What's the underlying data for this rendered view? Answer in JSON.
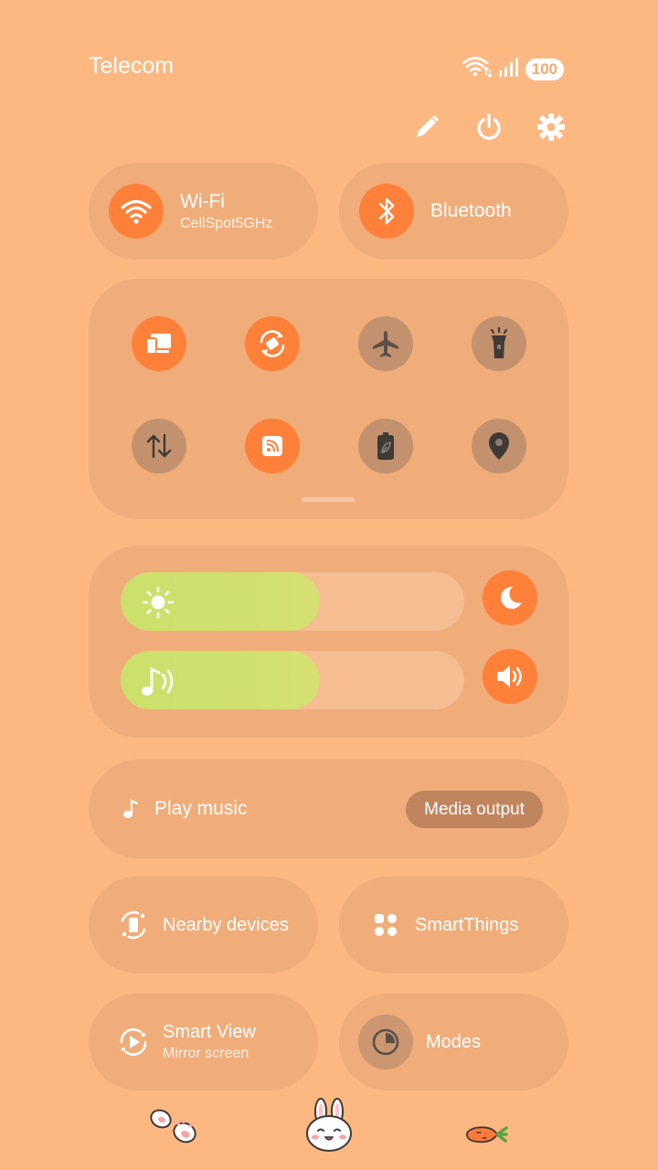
{
  "status": {
    "carrier": "Telecom",
    "battery": "100"
  },
  "top_actions": [
    {
      "name": "edit-icon"
    },
    {
      "name": "power-icon"
    },
    {
      "name": "settings-icon"
    }
  ],
  "wifi": {
    "title": "Wi-Fi",
    "subtitle": "CellSpot5GHz",
    "state": "on"
  },
  "bluetooth": {
    "title": "Bluetooth",
    "state": "on"
  },
  "quick_toggles": [
    {
      "name": "screen-share-icon",
      "state": "on"
    },
    {
      "name": "auto-rotate-icon",
      "state": "on"
    },
    {
      "name": "airplane-icon",
      "state": "off"
    },
    {
      "name": "flashlight-icon",
      "state": "off"
    },
    {
      "name": "mobile-data-icon",
      "state": "off"
    },
    {
      "name": "hotspot-icon",
      "state": "on"
    },
    {
      "name": "power-saving-icon",
      "state": "off"
    },
    {
      "name": "location-icon",
      "state": "off"
    }
  ],
  "sliders": {
    "brightness": {
      "level": 0.58,
      "icon": "sun-icon"
    },
    "volume": {
      "level": 0.58,
      "icon": "music-note-icon"
    }
  },
  "side_buttons": {
    "dark_mode": "moon-icon",
    "sound": "speaker-icon"
  },
  "media": {
    "play_label": "Play music",
    "output_label": "Media output"
  },
  "tiles": {
    "nearby": {
      "label": "Nearby devices"
    },
    "smartthings": {
      "label": "SmartThings"
    },
    "smartview": {
      "title": "Smart View",
      "subtitle": "Mirror screen"
    },
    "modes": {
      "label": "Modes"
    }
  },
  "colors": {
    "background": "#FDB882",
    "accent": "#FF8039",
    "slider_fill": "#CCE06C"
  }
}
